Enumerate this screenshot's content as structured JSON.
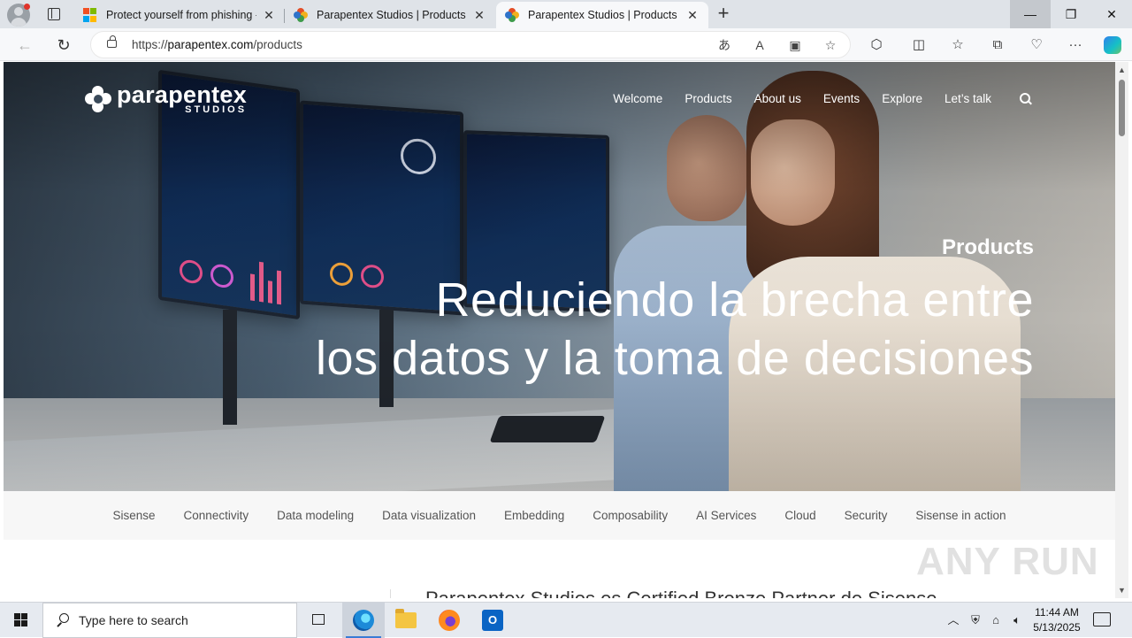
{
  "browser": {
    "tabs": [
      {
        "title": "Protect yourself from phishing - M",
        "favicon": "microsoft-icon",
        "active": false
      },
      {
        "title": "Parapentex Studios | Products",
        "favicon": "parapentex-icon",
        "active": false
      },
      {
        "title": "Parapentex Studios | Products",
        "favicon": "parapentex-icon",
        "active": true
      }
    ],
    "url_scheme": "https://",
    "url_host": "parapentex.com",
    "url_path": "/products",
    "window_controls": {
      "minimize": "—",
      "restore": "❐",
      "close": "✕"
    }
  },
  "site": {
    "logo_name": "parapentex",
    "logo_sub": "STUDIOS",
    "nav": [
      "Welcome",
      "Products",
      "About us",
      "Events",
      "Explore",
      "Let’s talk"
    ],
    "hero_eyebrow": "Products",
    "hero_title_line1": "Reduciendo la brecha entre",
    "hero_title_line2": "los datos y la toma de decisiones",
    "subnav": [
      "Sisense",
      "Connectivity",
      "Data modeling",
      "Data visualization",
      "Embedding",
      "Composability",
      "AI Services",
      "Cloud",
      "Security",
      "Sisense in action"
    ],
    "partial_heading": "Parapentex Studios es Certified Bronze Partner de Sisense"
  },
  "watermark": "ANY RUN",
  "taskbar": {
    "search_placeholder": "Type here to search",
    "time": "11:44 AM",
    "date": "5/13/2025",
    "outlook_letter": "O"
  },
  "colors": {
    "accent": "#1d8ad8",
    "tab_strip": "#dfe3e8",
    "taskbar": "#e6eaf0"
  }
}
